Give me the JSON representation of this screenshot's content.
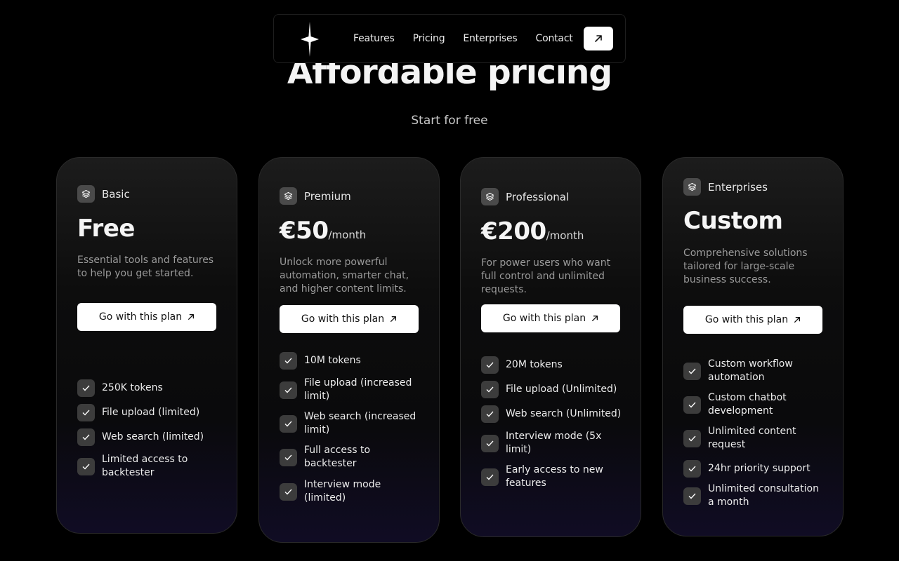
{
  "nav": {
    "logo_icon": "sparkle-star-icon",
    "links": [
      "Features",
      "Pricing",
      "Enterprises",
      "Contact"
    ],
    "cta_icon": "arrow-up-right-icon"
  },
  "hero": {
    "title": "Affordable pricing",
    "subtitle": "Start for free"
  },
  "plans": [
    {
      "name": "Basic",
      "icon": "layers-icon",
      "price": "Free",
      "period": "",
      "description": "Essential tools and features to help you get started.",
      "button": "Go with this plan",
      "features": [
        "250K tokens",
        "File upload (limited)",
        "Web search (limited)",
        "Limited access to backtester"
      ]
    },
    {
      "name": "Premium",
      "icon": "layers-icon",
      "price": "€50",
      "period": "/month",
      "description": "Unlock more powerful automation, smarter chat, and higher content limits.",
      "button": "Go with this plan",
      "features": [
        "10M tokens",
        "File upload (increased limit)",
        "Web search (increased limit)",
        "Full access to backtester",
        "Interview mode (limited)"
      ]
    },
    {
      "name": "Professional",
      "icon": "layers-icon",
      "price": "€200",
      "period": "/month",
      "description": "For power users who want full control and unlimited requests.",
      "button": "Go with this plan",
      "features": [
        "20M tokens",
        "File upload (Unlimited)",
        "Web search (Unlimited)",
        "Interview mode (5x limit)",
        "Early access to new features"
      ]
    },
    {
      "name": "Enterprises",
      "icon": "layers-icon",
      "price": "Custom",
      "period": "",
      "description": "Comprehensive solutions tailored for large-scale business success.",
      "button": "Go with this plan",
      "features": [
        "Custom workflow automation",
        "Custom chatbot development",
        "Unlimited content request",
        "24hr priority support",
        "Unlimited consultation a month"
      ]
    }
  ]
}
